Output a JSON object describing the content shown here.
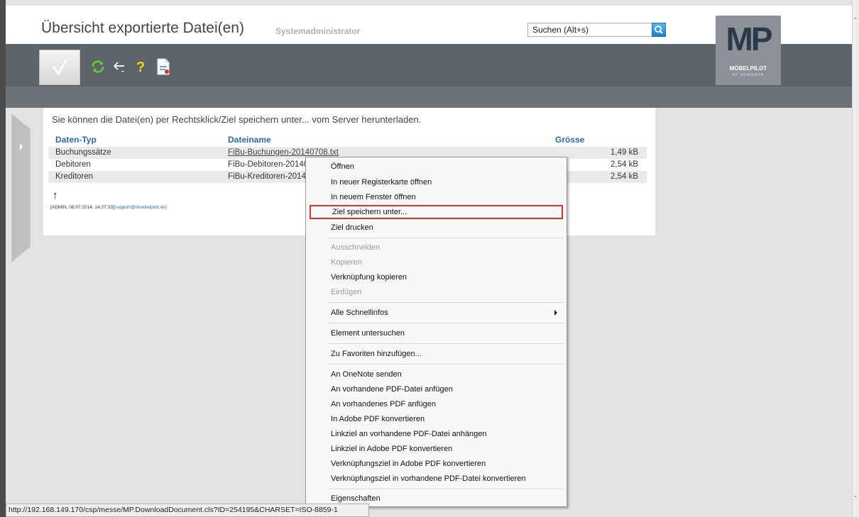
{
  "header": {
    "title": "Übersicht exportierte Datei(en)",
    "user": "Systemadministrator",
    "search_value": "Suchen (Alt+s)"
  },
  "toolbar": {
    "icons": [
      "check-icon",
      "refresh-icon",
      "back-icon",
      "help-icon",
      "document-icon"
    ]
  },
  "logo": {
    "mark": "MP",
    "name": "MÖBELPILOT",
    "sub": "BY SEMIDATA"
  },
  "content": {
    "info": "Sie können die Datei(en) per Rechtsklick/Ziel speichern unter... vom Server herunterladen.",
    "columns": [
      "Daten-Typ",
      "Dateiname",
      "Grösse"
    ],
    "rows": [
      {
        "type": "Buchungssätze",
        "file": "FiBu-Buchungen-20140708.txt",
        "size": "1,49 kB"
      },
      {
        "type": "Debitoren",
        "file": "FiBu-Debitoren-201407",
        "size": "2,54 kB"
      },
      {
        "type": "Kreditoren",
        "file": "FiBu-Kreditoren-20140",
        "size": "2,54 kB"
      }
    ],
    "footer_meta": "[ADMIN, 08.07.2014, 14:27:33]",
    "footer_email": "[support@moebelpilot.de]"
  },
  "context_menu": {
    "items": [
      "Öffnen",
      "In neuer Registerkarte öffnen",
      "In neuem Fenster öffnen",
      "Ziel speichern unter...",
      "Ziel drucken",
      "Ausschneiden",
      "Kopieren",
      "Verknüpfung kopieren",
      "Einfügen",
      "Alle Schnellinfos",
      "Element untersuchen",
      "Zu Favoriten hinzufügen...",
      "An OneNote senden",
      "An vorhandene PDF-Datei anfügen",
      "An vorhandenes PDF anfügen",
      "In Adobe PDF konvertieren",
      "Linkziel an vorhandene PDF-Datei anhängen",
      "Linkziel in Adobe PDF konvertieren",
      "Verknüpfungsziel in Adobe PDF konvertieren",
      "Verknüpfungsziel in vorhandene PDF-Datei konvertieren",
      "Eigenschaften"
    ],
    "highlighted_color": "#d9332a"
  },
  "statusbar": {
    "url": "http://192.168.149.170/csp/messe/MP.DownloadDocument.cls?ID=254195&CHARSET=ISO-8859-1"
  }
}
